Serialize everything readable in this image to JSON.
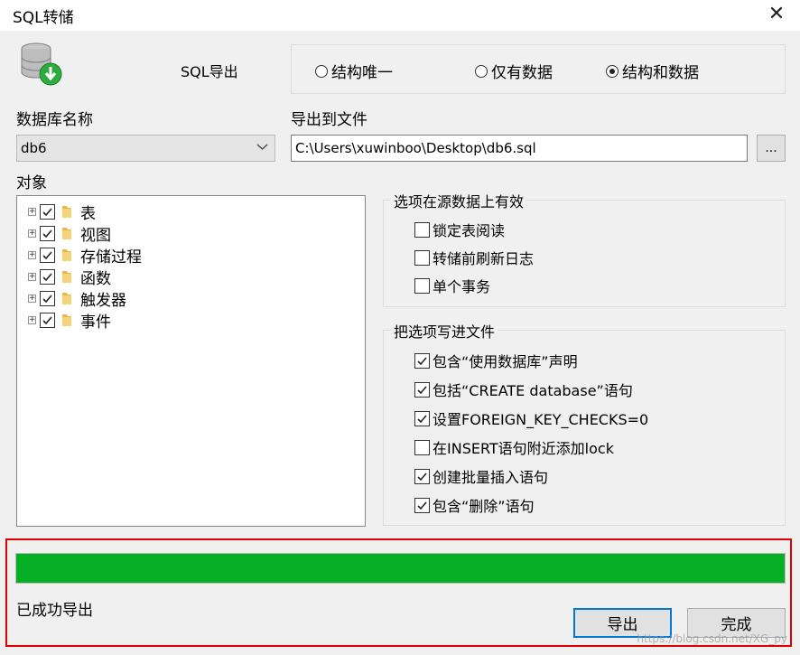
{
  "window": {
    "title": "SQL转储"
  },
  "header": {
    "export_title": "SQL导出"
  },
  "export_mode": {
    "options": [
      {
        "label": "结构唯一",
        "selected": false
      },
      {
        "label": "仅有数据",
        "selected": false
      },
      {
        "label": "结构和数据",
        "selected": true
      }
    ]
  },
  "database": {
    "label": "数据库名称",
    "selected": "db6"
  },
  "file": {
    "label": "导出到文件",
    "value": "C:\\Users\\xuwinboo\\Desktop\\db6.sql",
    "browse_label": "..."
  },
  "objects": {
    "label": "对象",
    "items": [
      {
        "label": "表",
        "checked": true
      },
      {
        "label": "视图",
        "checked": true
      },
      {
        "label": "存储过程",
        "checked": true
      },
      {
        "label": "函数",
        "checked": true
      },
      {
        "label": "触发器",
        "checked": true
      },
      {
        "label": "事件",
        "checked": true
      }
    ]
  },
  "source_options": {
    "title": "选项在源数据上有效",
    "items": [
      {
        "label": "锁定表阅读",
        "checked": false
      },
      {
        "label": "转储前刷新日志",
        "checked": false
      },
      {
        "label": "单个事务",
        "checked": false
      }
    ]
  },
  "file_options": {
    "title": "把选项写进文件",
    "items": [
      {
        "label": "包含“使用数据库”声明",
        "checked": true
      },
      {
        "label": "包括“CREATE database”语句",
        "checked": true
      },
      {
        "label": "设置FOREIGN_KEY_CHECKS=0",
        "checked": true
      },
      {
        "label": "在INSERT语句附近添加lock",
        "checked": false
      },
      {
        "label": "创建批量插入语句",
        "checked": true
      },
      {
        "label": "包含“删除”语句",
        "checked": true
      }
    ]
  },
  "progress": {
    "value": 1.0,
    "color": "#06b025"
  },
  "status": {
    "text": "已成功导出"
  },
  "buttons": {
    "export": "导出",
    "finish": "完成"
  },
  "watermark": "https://blog.csdn.net/XG_py"
}
